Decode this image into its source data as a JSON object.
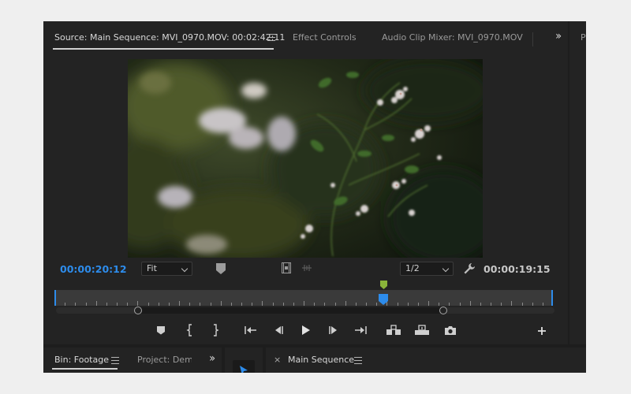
{
  "source_panel": {
    "tabs": [
      {
        "label": "Source: Main Sequence: MVI_0970.MOV: 00:02:42:11",
        "active": true
      },
      {
        "label": "Effect Controls",
        "active": false
      },
      {
        "label": "Audio Clip Mixer: MVI_0970.MOV",
        "active": false
      }
    ],
    "overflow_icon": "double-chevron-right-icon",
    "timecode_current": "00:00:20:12",
    "timecode_duration": "00:00:19:15",
    "zoom_select": {
      "value": "Fit"
    },
    "resolution_select": {
      "value": "1/2"
    },
    "playhead_fraction": 0.66,
    "accent_color": "#2d8ceb"
  },
  "transport_controls": [
    {
      "name": "add-marker-button",
      "icon": "marker-icon"
    },
    {
      "name": "mark-in-button",
      "icon": "mark-in-icon"
    },
    {
      "name": "mark-out-button",
      "icon": "mark-out-icon"
    },
    {
      "name": "go-to-in-button",
      "icon": "go-to-in-icon"
    },
    {
      "name": "step-back-button",
      "icon": "step-back-icon"
    },
    {
      "name": "play-button",
      "icon": "play-icon"
    },
    {
      "name": "step-forward-button",
      "icon": "step-forward-icon"
    },
    {
      "name": "go-to-out-button",
      "icon": "go-to-out-icon"
    },
    {
      "name": "insert-button",
      "icon": "insert-icon"
    },
    {
      "name": "overwrite-button",
      "icon": "overwrite-icon"
    },
    {
      "name": "export-frame-button",
      "icon": "camera-icon"
    },
    {
      "name": "button-editor-button",
      "icon": "plus-icon"
    }
  ],
  "right_panel": {
    "tab_label": "P"
  },
  "bottom": {
    "bin_tab": "Bin: Footage",
    "project_tab": "Project: Demo",
    "sequence_tab": "Main Sequence"
  }
}
